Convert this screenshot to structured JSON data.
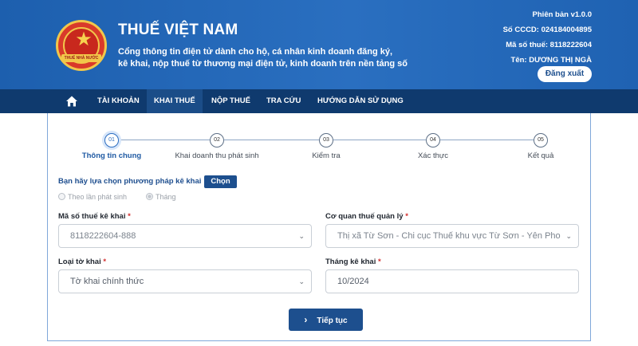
{
  "header": {
    "title": "THUẾ VIỆT NAM",
    "description_line1": "Cổng thông tin điện tử dành cho hộ, cá nhân kinh doanh đăng ký,",
    "description_line2": "kê khai, nộp thuế từ thương mại điện tử, kinh doanh trên nền tảng số",
    "emblem_text": "THUẾ NHÀ NƯỚC",
    "version": "Phiên bản v1.0.0",
    "cccd": "Số CCCD: 024184004895",
    "tax_code": "Mã số thuế: 8118222604",
    "name": "Tên: DƯƠNG THỊ NGÀ",
    "logout_label": "Đăng xuất"
  },
  "nav": {
    "home_icon": "home-icon",
    "items": [
      {
        "label": "TÀI KHOẢN",
        "active": false
      },
      {
        "label": "KHAI THUẾ",
        "active": true
      },
      {
        "label": "NỘP THUẾ",
        "active": false
      },
      {
        "label": "TRA CỨU",
        "active": false
      },
      {
        "label": "HƯỚNG DẪN SỬ DỤNG",
        "active": false
      }
    ]
  },
  "steps": [
    {
      "num": "01",
      "label": "Thông tin chung",
      "active": true
    },
    {
      "num": "02",
      "label": "Khai doanh thu phát sinh",
      "active": false
    },
    {
      "num": "03",
      "label": "Kiểm tra",
      "active": false
    },
    {
      "num": "04",
      "label": "Xác thực",
      "active": false
    },
    {
      "num": "05",
      "label": "Kết quả",
      "active": false
    }
  ],
  "method": {
    "prompt": "Bạn hãy lựa chọn phương pháp kê khai",
    "choose_label": "Chọn",
    "options": [
      "Theo lần phát sinh",
      "Tháng"
    ],
    "selected": "Tháng"
  },
  "form": {
    "tax_code_label": "Mã số thuế kê khai",
    "tax_code_value": "8118222604-888",
    "authority_label": "Cơ quan thuế quản lý",
    "authority_value": "Thị xã Từ Sơn - Chi cục Thuế khu vực Từ Sơn - Yên Pho",
    "declaration_type_label": "Loại tờ khai",
    "declaration_type_value": "Tờ khai chính thức",
    "period_label": "Tháng kê khai",
    "period_value": "10/2024",
    "required_mark": "*"
  },
  "actions": {
    "continue_label": "Tiếp tục"
  },
  "colors": {
    "header_bg": "#2a6fc0",
    "nav_bg": "#0f3a6e",
    "primary_button": "#1d4f8e",
    "required": "#d32f2f"
  }
}
